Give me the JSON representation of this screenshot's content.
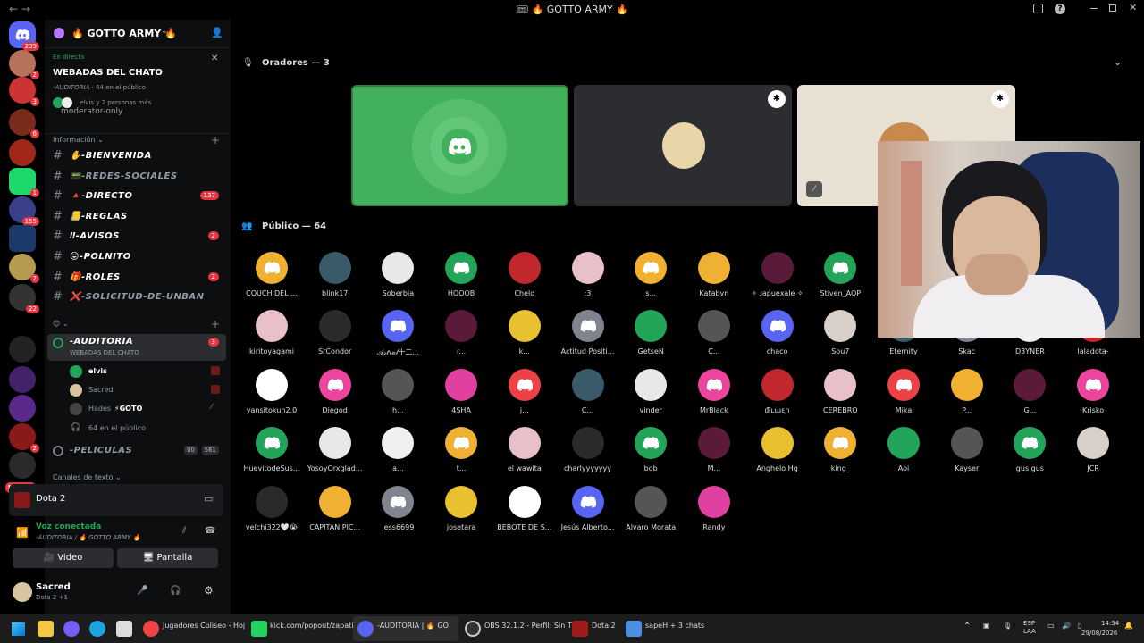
{
  "window": {
    "title": "🎟 🔥 GOTTO ARMY 🔥",
    "nav": "← →"
  },
  "server_badges": {
    "home": "239",
    "s1": "2",
    "s2": "3",
    "s3": "6",
    "s5": "1",
    "s6": "155",
    "s7": "2",
    "s8": "22",
    "s11": "2",
    "new": "NUEVO"
  },
  "guild": {
    "name": "🔥 GOTTO ARMY 🔥"
  },
  "live_event": {
    "tag": "En directo",
    "title": "WEBADAS DEL CHATO",
    "channel": "-AUDITORIA",
    "audience": "64 en el público",
    "people": "elvis y 2 personas más"
  },
  "moderator_only": "moderator-only",
  "category_info": "Información",
  "channels": [
    {
      "label": "✋-BIENVENIDA",
      "count": ""
    },
    {
      "label": "📟-REDES-SOCIALES",
      "count": ""
    },
    {
      "label": "🔺-DIRECTO",
      "count": "137"
    },
    {
      "label": "📒-REGLAS",
      "count": ""
    },
    {
      "label": "‼-AVISOS",
      "count": "2"
    },
    {
      "label": "😛-POLNITO",
      "count": ""
    },
    {
      "label": "🎁-ROLES",
      "count": "2"
    },
    {
      "label": "❌-SOLICITUD-DE-UNBAN",
      "count": ""
    }
  ],
  "stage_channel": {
    "label": "-AUDITORIA",
    "sub": "WEBADAS DEL CHATO",
    "count": "3"
  },
  "stage_members": [
    {
      "name": "elvis"
    },
    {
      "name": "Sacred"
    },
    {
      "name": "Hades",
      "tag": "⚡GOTO"
    },
    {
      "name": "64 en el público"
    }
  ],
  "peliculas": {
    "label": "-PELICULAS",
    "a": "00",
    "b": "561"
  },
  "category_text": "Canales de texto",
  "activity": {
    "game": "Dota 2"
  },
  "voice": {
    "status": "Voz conectada",
    "where": "-AUDITORIA / 🔥 GOTTO ARMY 🔥",
    "video": "Video",
    "screen": "Pantalla"
  },
  "user": {
    "name": "Sacred",
    "status": "Dota 2 +1"
  },
  "speakers_header": "Oradores — 3",
  "audience_header": "Público — 64",
  "audience": [
    [
      "COUCH DEL ...",
      "blink17",
      "Soberbia",
      "HOOOB",
      "Chelo",
      ":3",
      "s...",
      "Katabvn",
      "✧ ᴊapuexale ✧",
      "Stiven_AQP",
      "",
      "",
      ""
    ],
    [
      "kiritoyagami",
      "SrCondor",
      "𝒜𝓈𝓉𝓇𝒶𝓁十二...",
      "r...",
      "k...",
      "Actitud Positi...",
      "GetseN",
      "C...",
      "chaco",
      "Sou7",
      "Eternity",
      "Skac",
      "D3YNER",
      "laladota-"
    ],
    [
      "yansitokun2.0",
      "Diegod",
      "h...",
      "4SHA",
      "j...",
      "C...",
      "vinder",
      "MrBlack",
      "ᵭɨʟɯɛɲ",
      "CEREBRO",
      "Mika",
      "P...",
      "G...",
      "Krisko"
    ],
    [
      "HuevitodeSus...",
      "YosoyOrxglad...",
      "a...",
      "t...",
      "el wawita",
      "charlyyyyyyy",
      "bob",
      "M...",
      "Anghelo Hg",
      "king_",
      "Aoi",
      "Kayser",
      "gus gus",
      "JCR"
    ],
    [
      "velchi322🤍😭",
      "CAPITAN PIC...",
      "jess6699",
      "josetara",
      "BEBOTE DE S...",
      "Jesús Alberto...",
      "Alvaro Morata",
      "Randy"
    ]
  ],
  "taskbar": {
    "apps": [
      "Jugadores Coliseo - Hoj",
      "kick.com/popout/zapati",
      "-AUDITORIA | 🔥 GO",
      "OBS 32.1.2 - Perfil: Sin Tí",
      "Dota 2",
      "sapeH + 3 chats"
    ],
    "lang": "ESP\nLAA",
    "time": "14:34",
    "date": "29/08/2026"
  }
}
